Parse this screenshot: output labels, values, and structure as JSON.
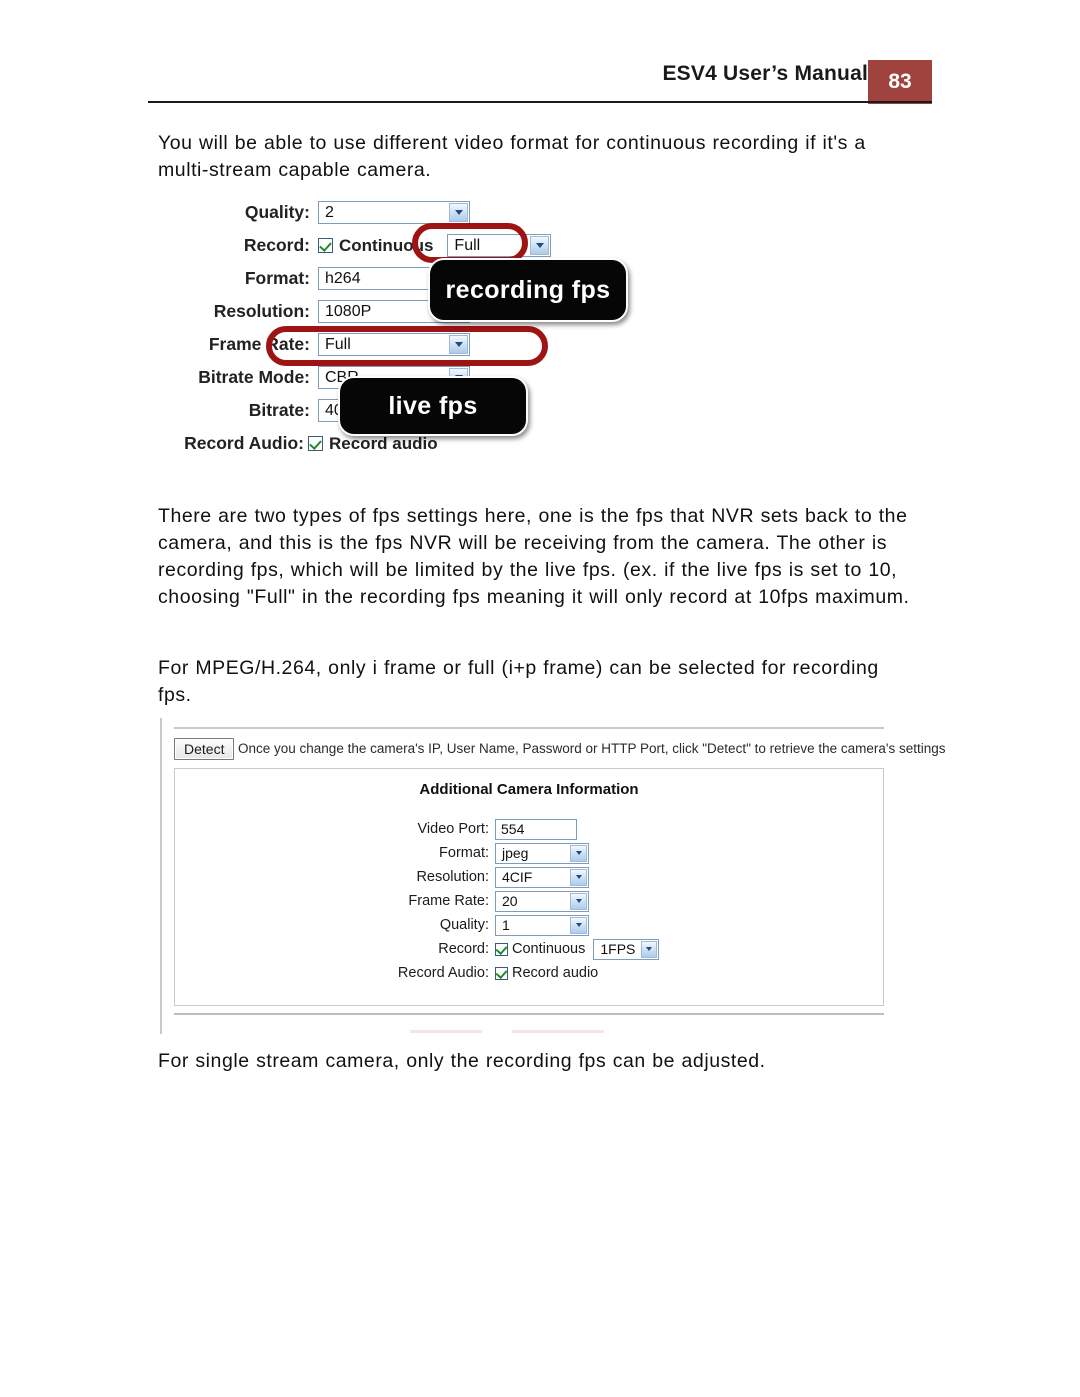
{
  "header": {
    "title": "ESV4 User’s Manual",
    "page_number": "83",
    "badge_color": "#a0423e"
  },
  "body": {
    "intro": "You will be able to use different video format for continuous recording if it's a multi-stream capable camera.",
    "fps_explanation": "There are two types of fps settings here, one is the fps that NVR sets back to the camera, and this is the fps NVR will be receiving from the camera. The other is recording fps, which will be limited by the live fps. (ex. if the live fps is set to 10, choosing \"Full\" in the recording fps meaning it will only record at 10fps maximum.",
    "mpeg_note": "For MPEG/H.264, only i frame or full (i+p frame) can be selected for recording fps.",
    "single_stream_note": "For single stream camera, only the recording fps can be adjusted."
  },
  "figure_multistream": {
    "annotation_color": "#9e1414",
    "callouts": {
      "recording_fps": "recording fps",
      "live_fps": "live fps"
    },
    "rows": {
      "quality_label": "Quality:",
      "quality_value": "2",
      "record_label": "Record:",
      "record_continuous_label": "Continuous",
      "record_fps_value": "Full",
      "format_label": "Format:",
      "resolution_label": "Resolution:",
      "frame_rate_label": "Frame Rate:",
      "frame_rate_value": "Full",
      "bitrate_mode_label": "Bitrate Mode:",
      "bitrate_label": "Bitrate:",
      "record_audio_label": "Record Audio:",
      "record_audio_checkbox_label": "Record audio"
    }
  },
  "figure_additional_camera": {
    "detect_button": "Detect",
    "detect_note": "Once you change the camera's IP, User Name, Password or HTTP Port, click \"Detect\" to retrieve the camera's settings",
    "panel_title": "Additional Camera Information",
    "fields": [
      {
        "label": "Video Port:",
        "value": "554",
        "control": "textbox"
      },
      {
        "label": "Format:",
        "value": "jpeg",
        "control": "select"
      },
      {
        "label": "Resolution:",
        "value": "4CIF",
        "control": "select"
      },
      {
        "label": "Frame Rate:",
        "value": "20",
        "control": "select"
      },
      {
        "label": "Quality:",
        "value": "1",
        "control": "select"
      }
    ],
    "record_label": "Record:",
    "record_continuous_label": "Continuous",
    "record_fps_value": "1FPS",
    "record_audio_label": "Record Audio:",
    "record_audio_checkbox_label": "Record audio"
  }
}
